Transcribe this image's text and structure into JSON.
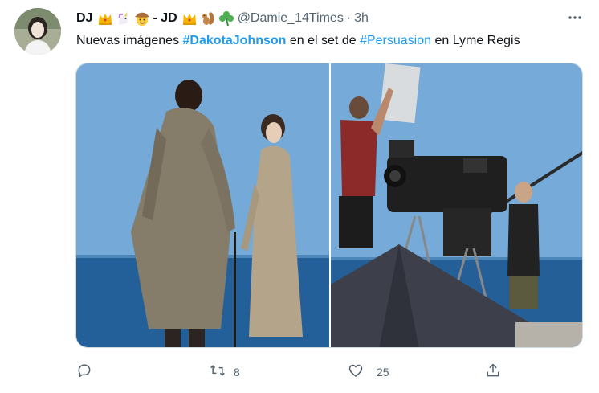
{
  "tweet": {
    "display_name_part1": "DJ",
    "display_name_part2": "- JD",
    "handle": "@Damie_14Times",
    "separator": "·",
    "time": "3h",
    "text_intro": "Nuevas imágenes ",
    "hashtag1": "#DakotaJohnson",
    "text_middle": " en el set de ",
    "hashtag2": "#Persuasion",
    "text_end": " en Lyme Regis",
    "retweets": "8",
    "likes": "25"
  },
  "icons": {
    "header_emojis": [
      "crown-icon",
      "unicorn-icon",
      "cowboy-face-icon",
      "crown-icon",
      "squirrel-icon",
      "shamrock-icon"
    ],
    "more": "more-icon",
    "reply": "reply-icon",
    "retweet": "retweet-icon",
    "like": "heart-icon",
    "share": "share-icon"
  },
  "colors": {
    "hashtag": "#1d9bf0",
    "secondary_text": "#536471",
    "sky": "#6fa6d6",
    "sea": "#1f5d97"
  }
}
